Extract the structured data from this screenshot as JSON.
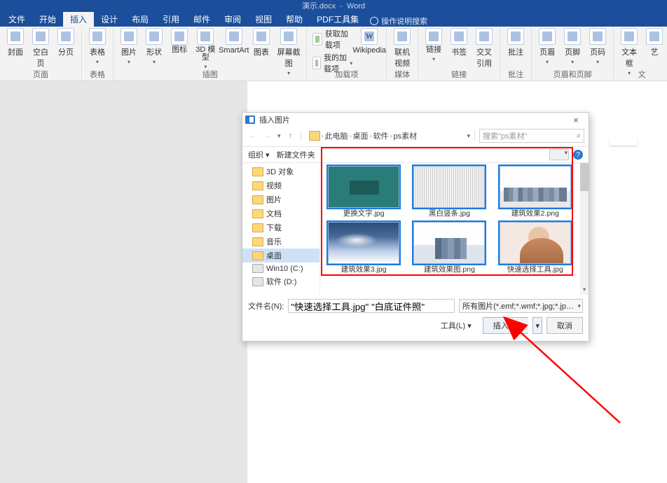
{
  "app": {
    "title_doc": "演示.docx",
    "title_app": "Word"
  },
  "tabs": {
    "file": "文件",
    "home": "开始",
    "insert": "插入",
    "design": "设计",
    "layout": "布局",
    "references": "引用",
    "mailings": "邮件",
    "review": "审阅",
    "view": "视图",
    "help": "帮助",
    "pdf": "PDF工具集",
    "tellme": "操作说明搜索"
  },
  "ribbon": {
    "pages": {
      "cover": "封面",
      "blank": "空白页",
      "break": "分页",
      "group": "页面"
    },
    "tables": {
      "table": "表格",
      "group": "表格"
    },
    "illus": {
      "pic": "图片",
      "shapes": "形状",
      "icons": "图标",
      "3d": "3D 模型",
      "smartart": "SmartArt",
      "chart": "图表",
      "screenshot": "屏幕截图",
      "group": "插图"
    },
    "addins": {
      "get": "获取加载项",
      "my": "我的加载项",
      "wikipedia": "Wikipedia",
      "group": "加载项",
      "w": "W"
    },
    "media": {
      "video": "联机视频",
      "group": "媒体"
    },
    "links": {
      "link": "链接",
      "bookmark": "书签",
      "cross": "交叉引用",
      "group": "链接"
    },
    "comments": {
      "comment": "批注",
      "group": "批注"
    },
    "headerfooter": {
      "header": "页眉",
      "footer": "页脚",
      "number": "页码",
      "group": "页眉和页脚"
    },
    "text": {
      "textbox": "文本框",
      "wordart": "艺",
      "group": "文"
    }
  },
  "dialog": {
    "title": "插入图片",
    "close": "×",
    "nav": {
      "back": "←",
      "fwd": "→",
      "up": "↑",
      "dd": "▾",
      "sep": "›",
      "root": "此电脑",
      "p1": "桌面",
      "p2": "软件",
      "p3": "ps素材"
    },
    "search": {
      "placeholder": "搜索\"ps素材\"",
      "icon": "⌕"
    },
    "toolbar": {
      "org": "组织 ▾",
      "newfolder": "新建文件夹",
      "help": "?"
    },
    "tree": {
      "t3d": "3D 对象",
      "video": "视频",
      "pictures": "图片",
      "docs": "文档",
      "downloads": "下载",
      "music": "音乐",
      "desktop": "桌面",
      "win10": "Win10 (C:)",
      "soft": "软件 (D:)"
    },
    "thumbs": [
      {
        "cap": "更换文字.jpg",
        "cls": "teal"
      },
      {
        "cap": "黑白竖条.jpg",
        "cls": "bwstripe"
      },
      {
        "cap": "建筑效果2.png",
        "cls": "bldg2"
      },
      {
        "cap": "建筑效果3.jpg",
        "cls": "sky"
      },
      {
        "cap": "建筑效果图.png",
        "cls": "bldg1"
      },
      {
        "cap": "快速选择工具.jpg",
        "cls": "girl"
      }
    ],
    "file": {
      "label": "文件名(N):",
      "value": "\"快速选择工具.jpg\" \"白底证件照\"",
      "filter": "所有图片(*.emf;*.wmf;*.jpg;*.jp…"
    },
    "buttons": {
      "tools": "工具(L)  ▾",
      "insert": "插入(S)",
      "dd": "▾",
      "cancel": "取消"
    }
  }
}
